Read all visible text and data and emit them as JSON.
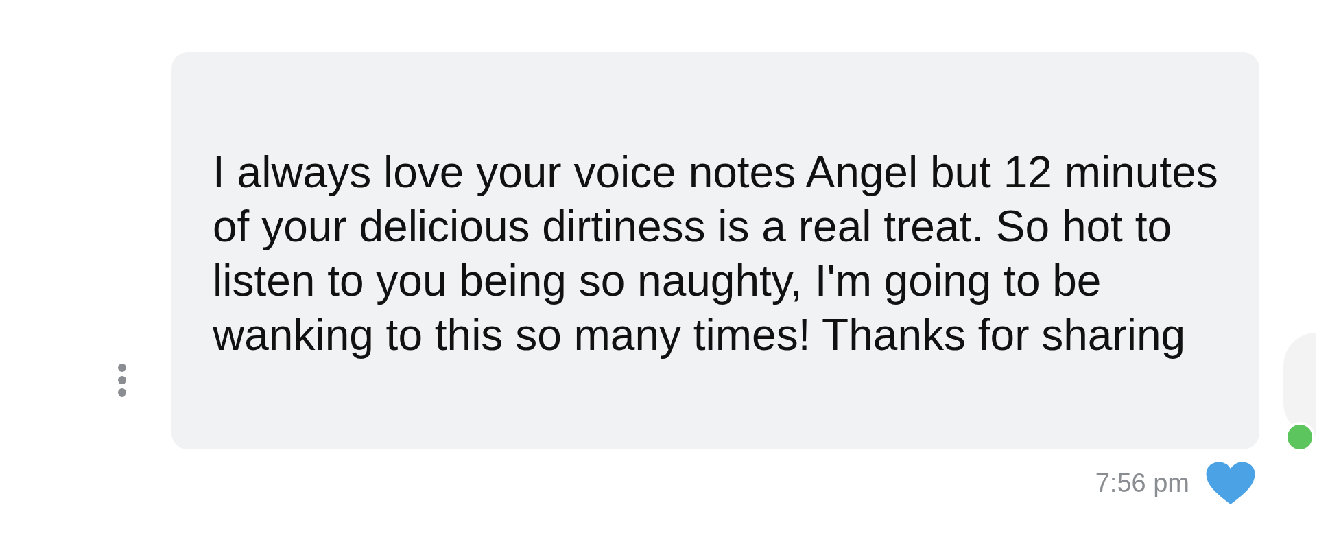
{
  "message": {
    "text": "I always love your voice notes Angel but 12 minutes of your delicious dirtiness is a real treat. So hot to listen to you being so naughty, I'm going to be wanking to this so many times! Thanks for sharing",
    "time": "7:56 pm",
    "liked": true
  },
  "sender": {
    "online": true
  }
}
